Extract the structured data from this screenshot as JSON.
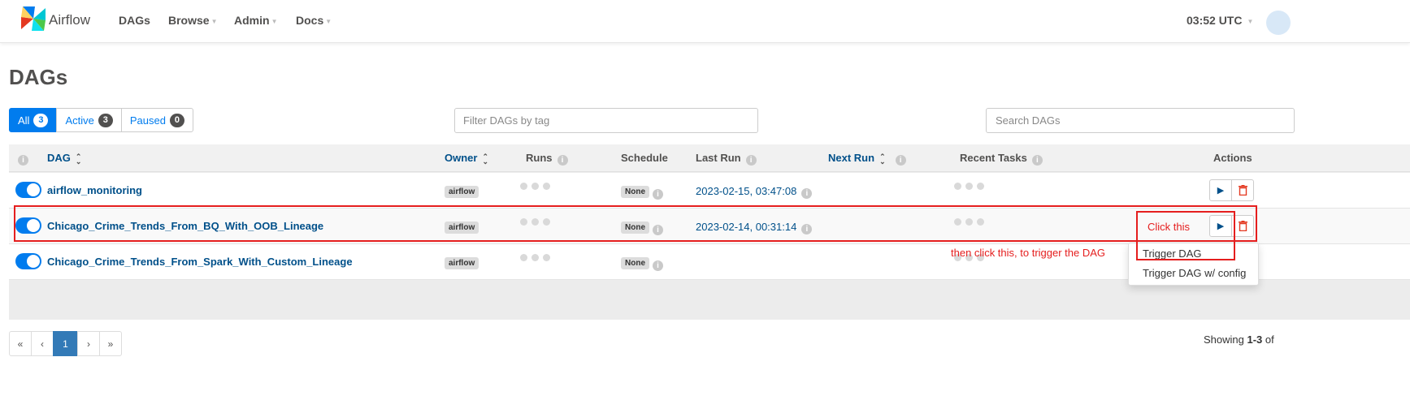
{
  "app": {
    "brand": "Airflow",
    "nav": [
      "DAGs",
      "Browse",
      "Admin",
      "Docs"
    ],
    "clock": "03:52 UTC"
  },
  "page": {
    "title": "DAGs"
  },
  "status_tabs": [
    {
      "label": "All",
      "count": "3"
    },
    {
      "label": "Active",
      "count": "3"
    },
    {
      "label": "Paused",
      "count": "0"
    }
  ],
  "filter": {
    "placeholder": "Filter DAGs by tag"
  },
  "search": {
    "placeholder": "Search DAGs"
  },
  "table": {
    "headers": {
      "dag": "DAG",
      "owner": "Owner",
      "runs": "Runs",
      "schedule": "Schedule",
      "last_run": "Last Run",
      "next_run": "Next Run",
      "recent_tasks": "Recent Tasks",
      "actions": "Actions"
    },
    "rows": [
      {
        "dag_id": "airflow_monitoring",
        "owner": "airflow",
        "schedule": "None",
        "last_run": "2023-02-15, 03:47:08"
      },
      {
        "dag_id": "Chicago_Crime_Trends_From_BQ_With_OOB_Lineage",
        "owner": "airflow",
        "schedule": "None",
        "last_run": "2023-02-14, 00:31:14"
      },
      {
        "dag_id": "Chicago_Crime_Trends_From_Spark_With_Custom_Lineage",
        "owner": "airflow",
        "schedule": "None",
        "last_run": ""
      }
    ]
  },
  "dropdown": {
    "items": [
      "Trigger DAG",
      "Trigger DAG w/ config"
    ]
  },
  "annotations": {
    "click_this": "Click this",
    "then_click": "then click this, to trigger the DAG"
  },
  "pagination": {
    "first": "«",
    "prev": "‹",
    "current": "1",
    "next": "›",
    "last": "»"
  },
  "footer": {
    "showing_prefix": "Showing",
    "showing_range": "1-3",
    "showing_suffix": "of"
  },
  "colors": {
    "brand_blue": "#017cee",
    "link_blue": "#00508a",
    "annotation_red": "#e51e1e",
    "delete_red": "#e43921"
  }
}
